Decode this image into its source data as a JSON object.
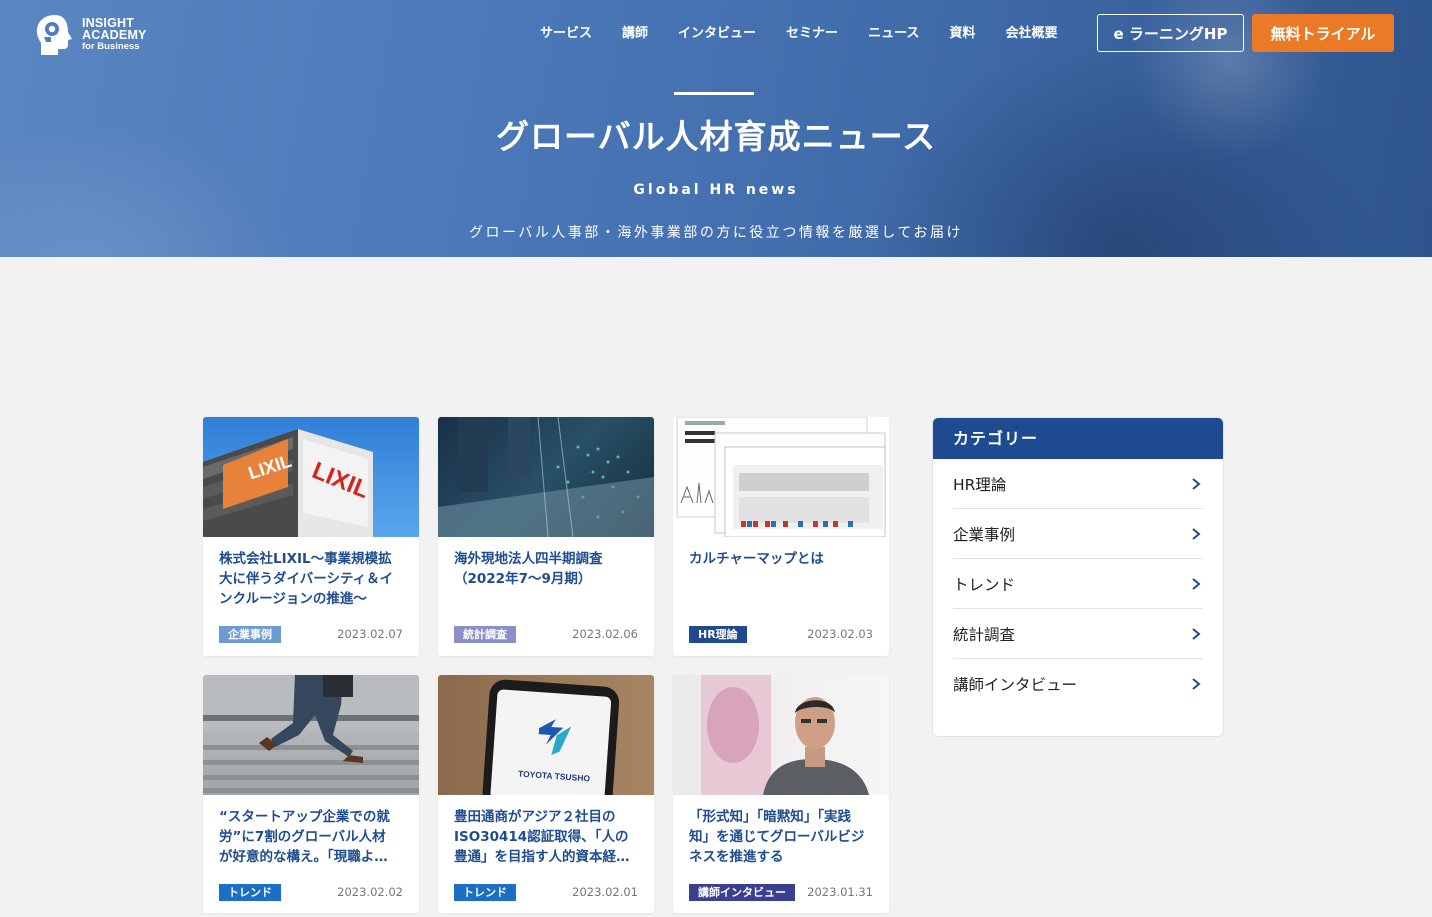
{
  "brand": {
    "line1": "INSIGHT",
    "line2": "ACADEMY",
    "line3": "for Business"
  },
  "nav": [
    "サービス",
    "講師",
    "インタビュー",
    "セミナー",
    "ニュース",
    "資料",
    "会社概要"
  ],
  "header_buttons": {
    "elearning": "e ラーニングHP",
    "trial": "無料トライアル"
  },
  "hero": {
    "title": "グローバル人材育成ニュース",
    "subtitle": "Global HR news",
    "description": "グローバル人事部・海外事業部の方に役立つ情報を厳選してお届け"
  },
  "articles": [
    {
      "title": "株式会社LIXIL～事業規模拡大に伴うダイバーシティ＆インクルージョンの推進～",
      "title_lines": [
        "株式会社LIXIL～事業規模拡",
        "大に伴うダイバーシティ＆イ",
        "ンクルージョンの推進～"
      ],
      "tag": "企業事例",
      "tag_color": "#6b9bd1",
      "date": "2023.02.07",
      "image_text": "LIXIL"
    },
    {
      "title": "海外現地法人四半期調査（2022年7～9月期）",
      "title_lines": [
        "海外現地法人四半期調査",
        "（2022年7～9月期）"
      ],
      "tag": "統計調査",
      "tag_color": "#8a8fc9",
      "date": "2023.02.06"
    },
    {
      "title": "カルチャーマップとは",
      "title_lines": [
        "カルチャーマップとは"
      ],
      "tag": "HR理論",
      "tag_color": "#1e4b8f",
      "date": "2023.02.03"
    },
    {
      "title": "“スタートアップ企業での就労”に7割のグローバル人材が好意的な構え。「現職よ…",
      "title_lines": [
        "“スタートアップ企業での就",
        "労”に7割のグローバル人材",
        "が好意的な構え。「現職よ…"
      ],
      "tag": "トレンド",
      "tag_color": "#1c6fc5",
      "date": "2023.02.02"
    },
    {
      "title": "豊田通商がアジア２社目のISO30414認証取得、「人の豊通」を目指す人的資本経…",
      "title_lines": [
        "豊田通商がアジア２社目の",
        "ISO30414認証取得、「人の",
        "豊通」を目指す人的資本経…"
      ],
      "tag": "トレンド",
      "tag_color": "#1c6fc5",
      "date": "2023.02.01",
      "image_text": "TOYOTA TSUSHO"
    },
    {
      "title": "「形式知」「暗黙知」「実践知」を通じてグローバルビジネスを推進する",
      "title_lines": [
        "「形式知」「暗黙知」「実践",
        "知」を通じてグローバルビジ",
        "ネスを推進する"
      ],
      "tag": "講師インタビュー",
      "tag_color": "#3a3f8f",
      "date": "2023.01.31"
    }
  ],
  "sidebar": {
    "heading": "カテゴリー",
    "categories": [
      "HR理論",
      "企業事例",
      "トレンド",
      "統計調査",
      "講師インタビュー"
    ]
  }
}
